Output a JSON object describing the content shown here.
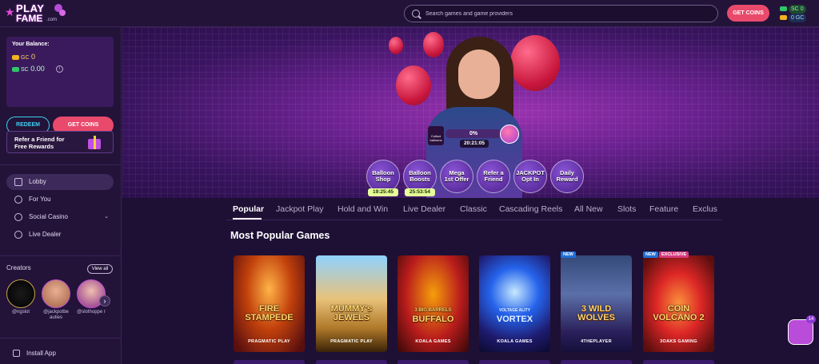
{
  "brand": {
    "line1": "PLAY",
    "line2": "FAME",
    "suffix": ".com"
  },
  "search": {
    "placeholder": "Search games and game providers"
  },
  "header": {
    "get_coins": "GET COINS",
    "sc_label": "SC",
    "sc_value": "0",
    "gc_label": "GC",
    "gc_value": "0"
  },
  "balance": {
    "title": "Your Balance:",
    "gc_label": "GC",
    "gc_value": "0",
    "sc_label": "SC",
    "sc_value": "0.00",
    "info_icon": "i"
  },
  "sidebar": {
    "redeem": "REDEEM",
    "get_coins": "GET COINS",
    "refer_line1": "Refer a Friend for",
    "refer_line2": "Free Rewards",
    "nav": [
      {
        "label": "Lobby",
        "icon": "grid-icon"
      },
      {
        "label": "For You",
        "icon": "star-icon"
      },
      {
        "label": "Social Casino",
        "icon": "chip-icon",
        "chevron": "⌄"
      },
      {
        "label": "Live Dealer",
        "icon": "dealer-icon"
      }
    ],
    "creators_title": "Creators",
    "view_all": "View all",
    "creators": [
      {
        "handle": "@ngslot"
      },
      {
        "handle": "@jackpotbe auties"
      },
      {
        "handle": "@slothoppe r"
      },
      {
        "handle": "@"
      }
    ],
    "creators_next": "›",
    "install": "Install App"
  },
  "hero": {
    "collect": "Collect balloons",
    "progress": "0%",
    "timer": "20:21:05",
    "promos": [
      {
        "line1": "Balloon",
        "line2": "Shop",
        "timer": "19:25:45"
      },
      {
        "line1": "Balloon",
        "line2": "Boosts",
        "timer": "25:53:54"
      },
      {
        "line1": "Mega",
        "line2": "1st Offer"
      },
      {
        "line1": "Refer a",
        "line2": "Friend"
      },
      {
        "line1": "JACKPOT",
        "line2": "Opt In"
      },
      {
        "line1": "Daily",
        "line2": "Reward"
      }
    ]
  },
  "tabs": [
    "Popular",
    "Jackpot Play",
    "Hold and Win",
    "Live Dealer",
    "Classic",
    "Cascading Reels",
    "All New",
    "Slots",
    "Feature",
    "Exclus"
  ],
  "section_title": "Most Popular Games",
  "games": [
    {
      "name_1": "FIRE",
      "name_2": "STAMPEDE",
      "provider": "PRAGMATIC PLAY",
      "badges": []
    },
    {
      "name_1": "MUMMY's",
      "name_2": "JEWELS",
      "provider": "PRAGMATIC PLAY",
      "badges": []
    },
    {
      "name_1": "3 BIG BARRELS",
      "name_2": "BUFFALO",
      "provider": "KOALA GAMES",
      "badges": []
    },
    {
      "name_1": "VOLTAGE ALITY",
      "name_2": "VORTEX",
      "provider": "KOALA GAMES",
      "badges": []
    },
    {
      "name_1": "3 WILD",
      "name_2": "WOLVES",
      "provider": "4THEPLAYER",
      "badges": [
        "NEW"
      ]
    },
    {
      "name_1": "COIN",
      "name_2": "VOLCANO 2",
      "provider": "3OAKS GAMING",
      "badges": [
        "NEW",
        "EXCLUSIVE"
      ]
    }
  ],
  "floating_gift": {
    "count": "14"
  }
}
